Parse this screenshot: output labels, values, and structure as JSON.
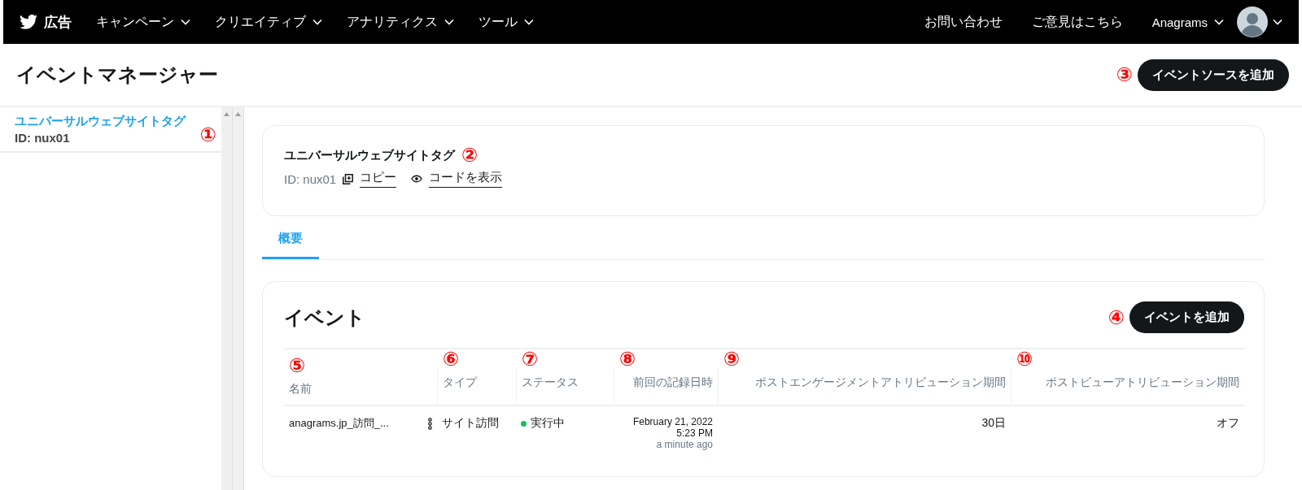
{
  "topbar": {
    "brand": "広告",
    "nav": [
      {
        "label": "キャンペーン"
      },
      {
        "label": "クリエイティブ"
      },
      {
        "label": "アナリティクス"
      },
      {
        "label": "ツール"
      }
    ],
    "links": [
      "お問い合わせ",
      "ご意見はこちら"
    ],
    "account": "Anagrams"
  },
  "page": {
    "title": "イベントマネージャー",
    "add_button": {
      "label": "イベントソースを追加",
      "callout": "③"
    }
  },
  "sidebar": {
    "items": [
      {
        "title": "ユニバーサルウェブサイトタグ",
        "id": "ID: nux01",
        "selected": true,
        "callout": "①"
      }
    ]
  },
  "source_card": {
    "title": "ユニバーサルウェブサイトタグ",
    "callout": "②",
    "id": "ID: nux01",
    "copy_link": "コピー",
    "code_link": "コードを表示"
  },
  "tabs": [
    {
      "label": "概要",
      "selected": true
    }
  ],
  "events": {
    "title": "イベント",
    "add_button": {
      "label": "イベントを追加",
      "callout": "④"
    },
    "columns": [
      {
        "label": "名前",
        "callout": "⑤"
      },
      {
        "label": "タイプ",
        "callout": "⑥"
      },
      {
        "label": "ステータス",
        "callout": "⑦"
      },
      {
        "label": "前回の記録日時",
        "callout": "⑧"
      },
      {
        "label": "ポストエンゲージメントアトリビューション期間",
        "callout": "⑨"
      },
      {
        "label": "ポストビューアトリビューション期間",
        "callout": "⑩"
      }
    ],
    "rows": [
      {
        "name": "anagrams.jp_訪問_...",
        "type": "サイト訪問",
        "status": "実行中",
        "color": "#17bf63",
        "last_date": "February 21, 2022",
        "last_time": "5:23 PM",
        "last_ago": "a minute ago",
        "engagement": "30日",
        "view": "オフ"
      }
    ]
  }
}
